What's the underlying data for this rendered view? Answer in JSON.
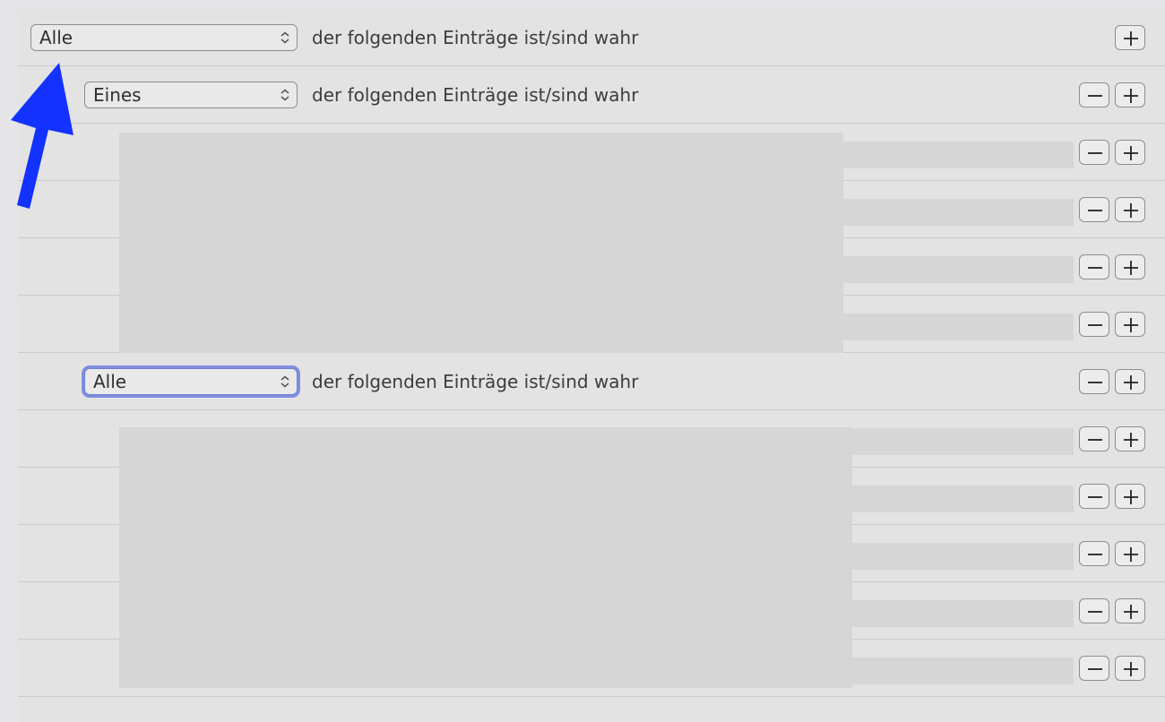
{
  "editor": {
    "header_row": {
      "popup_value": "Alle",
      "text": "der folgenden Einträge ist/sind wahr"
    },
    "groups": [
      {
        "popup_value": "Eines",
        "text": "der folgenden Einträge ist/sind wahr",
        "focused": false
      },
      {
        "popup_value": "Alle",
        "text": "der folgenden Einträge ist/sind wahr",
        "focused": true
      }
    ]
  },
  "colors": {
    "annotation_arrow": "#1432ff",
    "focus_ring": "#7f8ee0",
    "redaction": "#d6d6d6"
  },
  "icons": [
    "chevron-updown-icon",
    "minus-icon",
    "plus-icon",
    "arrow-up-icon"
  ]
}
